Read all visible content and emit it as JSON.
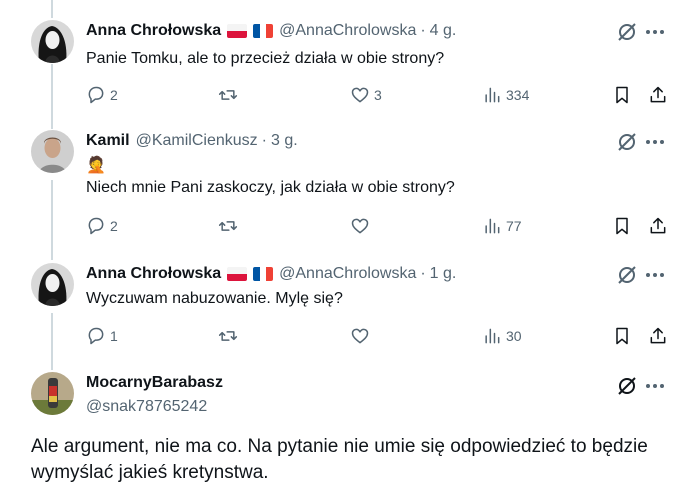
{
  "thread": [
    {
      "name": "Anna Chrołowska",
      "handle": "@AnnaChrolowska",
      "time": "4 g.",
      "text": "Panie Tomku, ale to przecież działa w obie strony?",
      "replies": "2",
      "retweets": "",
      "likes": "3",
      "views": "334"
    },
    {
      "name": "Kamil",
      "handle": "@KamilCienkusz",
      "time": "3 g.",
      "emoji": "🤦",
      "text": "Niech mnie Pani zaskoczy, jak działa w obie strony?",
      "replies": "2",
      "retweets": "",
      "likes": "",
      "views": "77"
    },
    {
      "name": "Anna Chrołowska",
      "handle": "@AnnaChrolowska",
      "time": "1 g.",
      "text": "Wyczuwam nabuzowanie. Mylę się?",
      "replies": "1",
      "retweets": "",
      "likes": "",
      "views": "30"
    }
  ],
  "main": {
    "name": "MocarnyBarabasz",
    "handle": "@snak78765242",
    "text": "Ale argument, nie ma co. Na pytanie nie umie się odpowiedzieć to będzie wymyślać jakieś kretynstwa."
  },
  "separator": "·",
  "icons": [
    "reply-icon",
    "retweet-icon",
    "like-icon",
    "views-icon",
    "bookmark-icon",
    "share-icon",
    "grok-icon",
    "more-icon"
  ],
  "colors": {
    "text": "#0f1419",
    "muted": "#536471",
    "thread_line": "#cfd9de"
  }
}
